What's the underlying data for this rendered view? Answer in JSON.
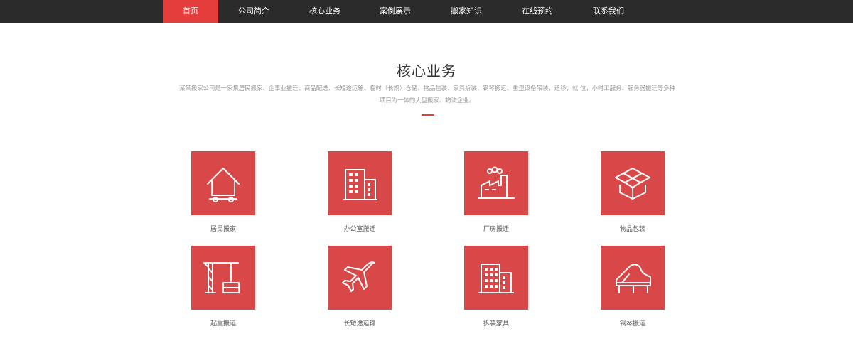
{
  "nav": {
    "items": [
      {
        "label": "首页",
        "active": true
      },
      {
        "label": "公司简介",
        "active": false
      },
      {
        "label": "核心业务",
        "active": false
      },
      {
        "label": "案例展示",
        "active": false
      },
      {
        "label": "搬家知识",
        "active": false
      },
      {
        "label": "在线预约",
        "active": false
      },
      {
        "label": "联系我们",
        "active": false
      }
    ]
  },
  "section": {
    "title": "核心业务",
    "description_line1": "某某搬家公司是一家集居民搬家、企事业搬迁、商品配送、长短途运输、临时（长期）仓储、物品包装、家具拆装、钢琴搬运、重型设备吊装，迁移，就 位，小时工服务、服务器搬迁等多种",
    "description_line2": "项目为一体的大型搬家、物流企业。"
  },
  "services": [
    {
      "label": "居民搬家",
      "icon": "house-truck-icon"
    },
    {
      "label": "办公室搬迁",
      "icon": "office-building-icon"
    },
    {
      "label": "厂房搬迁",
      "icon": "factory-icon"
    },
    {
      "label": "物品包装",
      "icon": "box-package-icon"
    },
    {
      "label": "起重搬运",
      "icon": "crane-icon"
    },
    {
      "label": "长短途运输",
      "icon": "airplane-icon"
    },
    {
      "label": "拆装家具",
      "icon": "building-icon"
    },
    {
      "label": "钢琴搬运",
      "icon": "piano-icon"
    }
  ],
  "colors": {
    "nav_bg": "#2b2b2b",
    "accent": "#e53c3c",
    "tile_bg": "#d94848",
    "desc_text": "#999999"
  }
}
